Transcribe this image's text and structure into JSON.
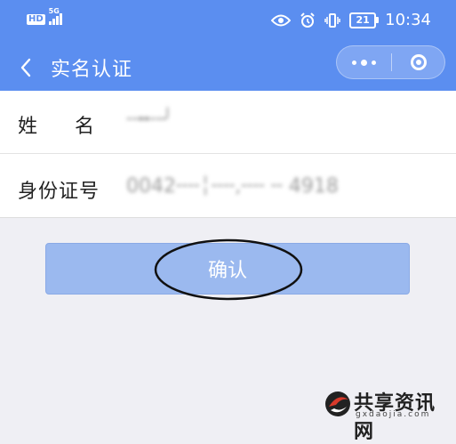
{
  "status_bar": {
    "hd_badge": "HD",
    "network": "5G",
    "battery": "21",
    "time": "10:34"
  },
  "navbar": {
    "title": "实名认证",
    "icons": [
      "back-arrow-icon",
      "more-dots-icon",
      "close-ring-icon"
    ]
  },
  "form": {
    "name_label": "姓名",
    "name_value": "╌╍╌╯",
    "id_label": "身份证号",
    "id_value": "0042╌╌╎╌╌,╌╌   ╌ 4918"
  },
  "confirm_label": "确认",
  "watermark": {
    "title": "共享资讯网",
    "url": "gxdaojia.com"
  },
  "colors": {
    "header_blue": "#5b8ef0",
    "button_blue": "#9bb9ef",
    "page_bg": "#efeff4"
  }
}
